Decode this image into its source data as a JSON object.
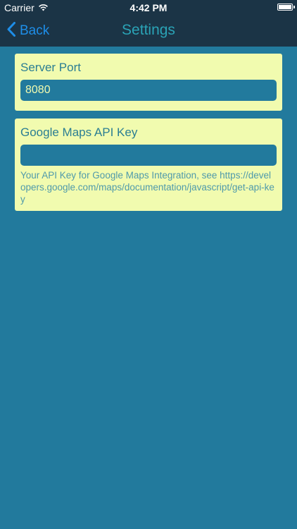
{
  "status_bar": {
    "carrier": "Carrier",
    "time": "4:42 PM",
    "battery_level": 1.0
  },
  "nav": {
    "back_label": "Back",
    "title": "Settings"
  },
  "server_port": {
    "label": "Server Port",
    "value": "8080"
  },
  "maps_api_key": {
    "label": "Google Maps API Key",
    "value": "",
    "help": "Your API Key for Google Maps Integration, see https://developers.google.com/maps/documentation/javascript/get-api-key"
  },
  "colors": {
    "background": "#227a9d",
    "bar": "#1b3446",
    "card": "#f1fbaf",
    "title": "#2aa3b6",
    "back": "#1e8ee8",
    "label": "#2b7e93"
  },
  "icons": {
    "wifi": "wifi-icon",
    "battery": "battery-icon",
    "back": "chevron-left-icon"
  }
}
